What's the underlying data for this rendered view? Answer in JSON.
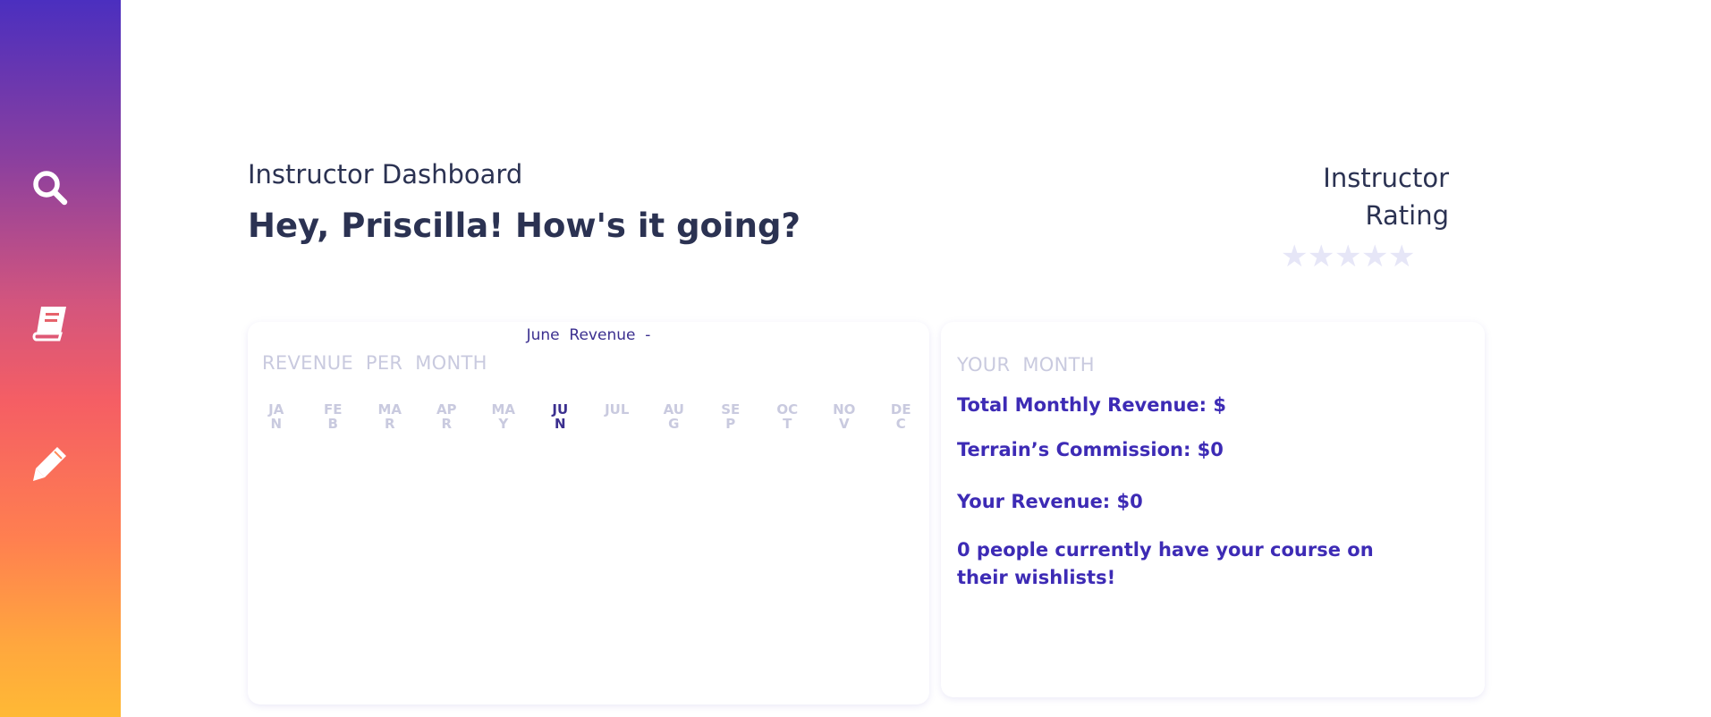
{
  "sidebar": {
    "items": [
      {
        "icon": "search-icon"
      },
      {
        "icon": "book-icon"
      },
      {
        "icon": "pencil-icon"
      }
    ]
  },
  "header": {
    "title": "Instructor Dashboard",
    "greeting": "Hey, Priscilla! How's it going?"
  },
  "rating": {
    "title": "Instructor Rating",
    "stars": 5,
    "filled": 0
  },
  "revenue_card": {
    "selected_label": "June  Revenue  -",
    "title": "REVENUE  PER  MONTH",
    "months": [
      "JAN",
      "FEB",
      "MAR",
      "APR",
      "MAY",
      "JUN",
      "JUL",
      "AUG",
      "SEP",
      "OCT",
      "NOV",
      "DEC"
    ],
    "active_month": "JUN"
  },
  "month_card": {
    "title": "YOUR  MONTH",
    "total_revenue": "Total Monthly Revenue: $",
    "commission": "Terrain’s Commission: $0",
    "your_revenue": "Your Revenue: $0",
    "wishlist": "0 people currently have your course on their wishlists!"
  },
  "colors": {
    "accent": "#3d2bb5",
    "heading": "#2b3252",
    "muted": "#c9cadf"
  }
}
